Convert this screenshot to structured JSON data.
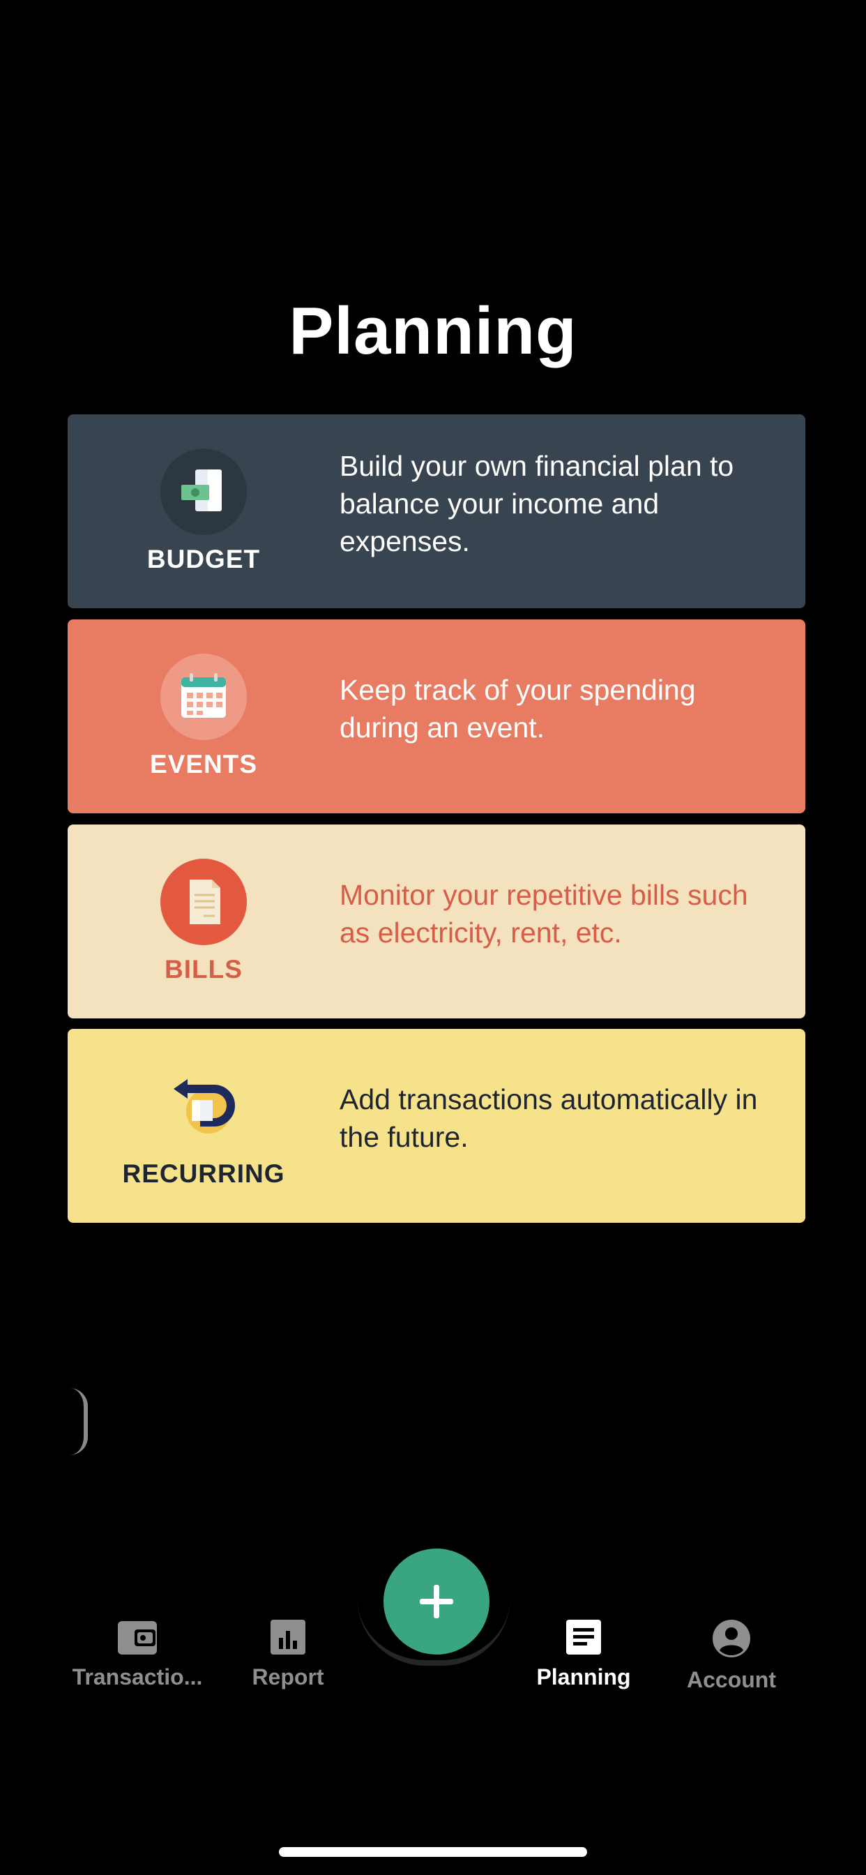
{
  "page": {
    "title": "Planning"
  },
  "cards": [
    {
      "id": "budget",
      "label": "BUDGET",
      "description": "Build your own financial plan to balance your income and expenses.",
      "icon": "budget-document-money-icon",
      "background": "#38444f"
    },
    {
      "id": "events",
      "label": "EVENTS",
      "description": "Keep track of your spending during an event.",
      "icon": "calendar-icon",
      "background": "#e87c63"
    },
    {
      "id": "bills",
      "label": "BILLS",
      "description": "Monitor your repetitive bills such as electricity, rent, etc.",
      "icon": "bill-document-icon",
      "background": "#f4e2bf"
    },
    {
      "id": "recurring",
      "label": "RECURRING",
      "description": "Add transactions automatically in the future.",
      "icon": "recurring-arrow-icon",
      "background": "#f5e28a"
    }
  ],
  "tabbar": {
    "tabs": [
      {
        "label": "Transactio...",
        "icon": "wallet-icon",
        "active": false
      },
      {
        "label": "Report",
        "icon": "bar-chart-icon",
        "active": false
      },
      {
        "label": "Planning",
        "icon": "document-icon",
        "active": true
      },
      {
        "label": "Account",
        "icon": "account-circle-icon",
        "active": false
      }
    ],
    "fab": {
      "icon": "plus-icon",
      "color": "#3aa583"
    }
  }
}
